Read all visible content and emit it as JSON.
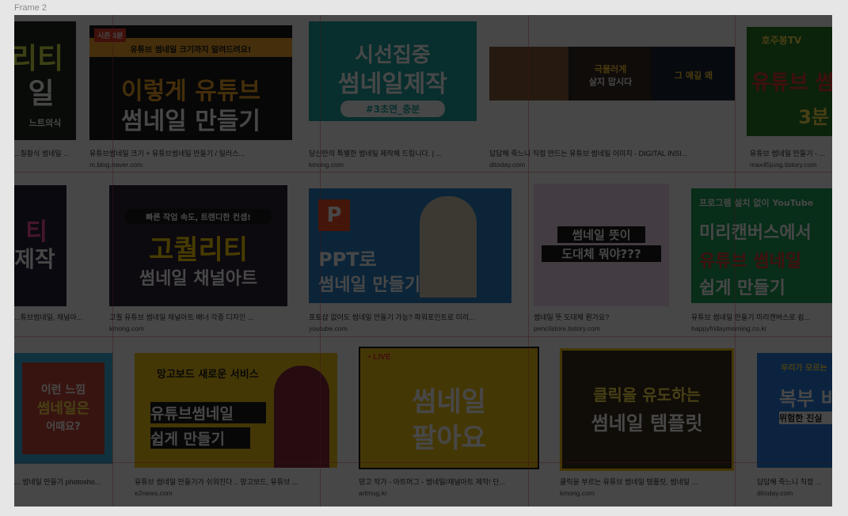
{
  "frame": {
    "label": "Frame 2"
  },
  "colors": {
    "overlay": "rgba(0,0,0,0.72)",
    "guide": "#dc4650"
  },
  "rows": [
    [
      {
        "caption": "...칠황식 썸네일 ...",
        "source": "",
        "lines": [
          "리티",
          "일",
          "느트의식"
        ]
      },
      {
        "caption": "유튜브썸네일 크기 + 유튜브썸네일 만들기 / 일러스...",
        "source": "m.blog.naver.com",
        "tag": "유튜브 썸네일 크기까지 알려드려요!",
        "badge": "시즌 3분",
        "lines": [
          "이렇게 유튜브",
          "썸네일 만들기"
        ]
      },
      {
        "caption": "당신만의 특별한 썸네일 제작해 드립니다. | ...",
        "source": "kmong.com",
        "lines": [
          "시선집중",
          "썸네일제작",
          "#3초면_충분"
        ]
      },
      {
        "caption": "답답해 죽느니 직접 만드는 유튜브 썸네일 이미지 - DIGITAL INSI...",
        "source": "ditoday.com",
        "lines": [
          "극물러게",
          "살지 맙시다",
          "그 얘길 왜"
        ]
      },
      {
        "caption": "유튜브 썸네일 만들기 - ...",
        "source": "max45jung.tistory.com",
        "tag": "호주봉TV",
        "lines": [
          "유튜브 썸",
          "3분"
        ]
      }
    ],
    [
      {
        "caption": "...튜브썸네일, 채널아...",
        "source": "",
        "lines": [
          "티",
          "일제작"
        ]
      },
      {
        "caption": "고퀄 유튜브 썸네일 채널아트 배너 각종 디자인 ...",
        "source": "kmong.com",
        "tag": "빠른 작업 속도, 트렌디한 컨셉!",
        "lines": [
          "고퀄리티",
          "썸네일 채널아트"
        ]
      },
      {
        "caption": "포토샵 없어도 썸네일 만들기 가능? 파워포인트로 미리...",
        "source": "youtube.com",
        "lines": [
          "PPT로",
          "썸네일 만들기"
        ]
      },
      {
        "caption": "썸네일 뜻 도대체 뭔가요?",
        "source": "pencilstore.tistory.com",
        "lines": [
          "썸네일 뜻이",
          "도대체 뭐야???"
        ]
      },
      {
        "caption": "유튜브 썸네일 만들기 미리캔버스로 쉽...",
        "source": "happyfridaymorning.co.kr",
        "tag": "프로그램 설치 없이 YouTube",
        "lines": [
          "미리캔버스에서",
          "유튜브 썸네일",
          "쉽게 만들기"
        ]
      }
    ],
    [
      {
        "caption": "... 썸네일 만들기 photosho...",
        "source": "",
        "lines": [
          "이런 느낌",
          "썸네일은",
          "어때요?"
        ]
      },
      {
        "caption": "유튜브 썸네일 만들기가 쉬워진다 .. 망고보드, 유튜브 ...",
        "source": "e2news.com",
        "tag": "망고보드 새로운 서비스",
        "lines": [
          "유튜브썸네일",
          "쉽게 만들기"
        ]
      },
      {
        "caption": "망고 작가 - 아트머그 - 썸네일/채널아트 제작! 단...",
        "source": "artmug.kr",
        "tag": "• LIVE",
        "lines": [
          "썸네일",
          "팔아요"
        ]
      },
      {
        "caption": "클릭을 부르는 유튜브 썸네일 템플릿, 썸네일 ...",
        "source": "kmong.com",
        "lines": [
          "클릭을 유도하는",
          "썸네일 템플릿"
        ]
      },
      {
        "caption": "답답해 죽느니 직접 ...",
        "source": "ditoday.com",
        "tag": "우리가 모르는",
        "lines": [
          "복부 비",
          "위험한 진실"
        ]
      }
    ]
  ]
}
